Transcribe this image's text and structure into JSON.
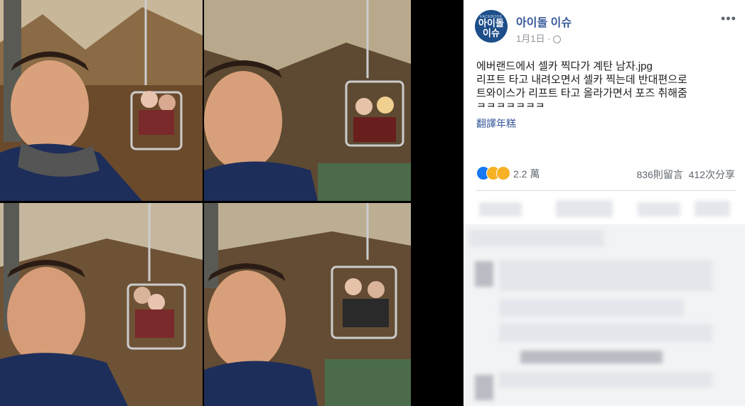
{
  "post": {
    "page_name": "아이돌 이슈",
    "avatar_small": "FACEBOOK",
    "avatar_line1": "아이돌",
    "avatar_line2": "이슈",
    "date": "1月1日 ·",
    "text_lines": [
      "에버랜드에서 셀카 찍다가 계탄 남자.jpg",
      "리프트 타고 내려오면서 셀카 찍는데 반대편으로",
      "트와이스가 리프트 타고 올라가면서 포즈 취해줌",
      "ㅋㅋㅋㅋㅋㅋㅋ"
    ],
    "translate_label": "翻譯年糕"
  },
  "stats": {
    "reaction_count": "2.2 萬",
    "comments": "836則留言",
    "shares": "412次分享"
  },
  "icons": {
    "more": "more-options-icon",
    "globe": "globe-icon",
    "like": "like-reaction-icon",
    "haha": "haha-reaction-icon",
    "wow": "wow-reaction-icon"
  },
  "colors": {
    "link": "#385898",
    "like": "#1877f2",
    "haha": "#f7b125"
  }
}
